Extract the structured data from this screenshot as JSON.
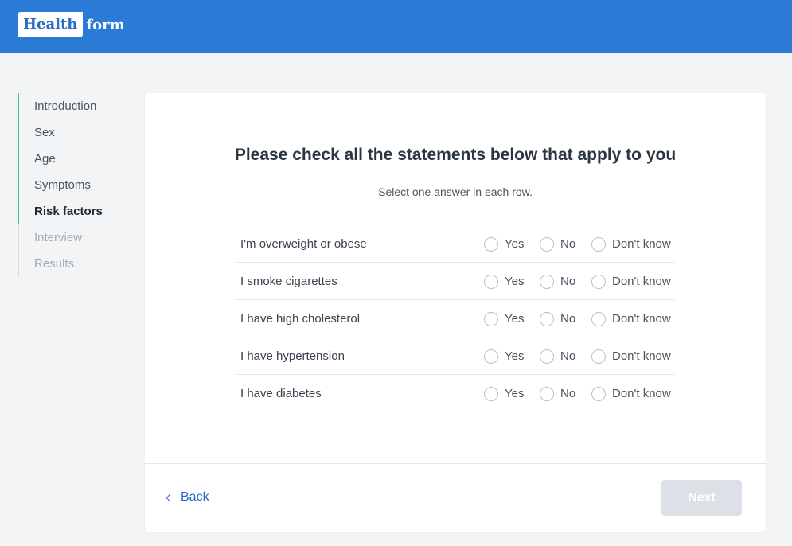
{
  "header": {
    "logo_health": "Health",
    "logo_form": "form",
    "color": "#2a7ad6"
  },
  "steps": [
    {
      "label": "Introduction",
      "state": "done"
    },
    {
      "label": "Sex",
      "state": "done"
    },
    {
      "label": "Age",
      "state": "done"
    },
    {
      "label": "Symptoms",
      "state": "done"
    },
    {
      "label": "Risk factors",
      "state": "active"
    },
    {
      "label": "Interview",
      "state": "future"
    },
    {
      "label": "Results",
      "state": "future"
    }
  ],
  "question": {
    "title": "Please check all the statements below that apply to you",
    "subtitle": "Select one answer in each row."
  },
  "options": {
    "yes": "Yes",
    "no": "No",
    "dont_know": "Don't know"
  },
  "rows": [
    {
      "label": "I'm overweight or obese"
    },
    {
      "label": "I smoke cigarettes"
    },
    {
      "label": "I have high cholesterol"
    },
    {
      "label": "I have hypertension"
    },
    {
      "label": "I have diabetes"
    }
  ],
  "footer": {
    "back_label": "Back",
    "next_label": "Next"
  },
  "colors": {
    "accent": "#2a6bc0",
    "progress": "#4cc483",
    "disabled": "#dde1e7"
  }
}
